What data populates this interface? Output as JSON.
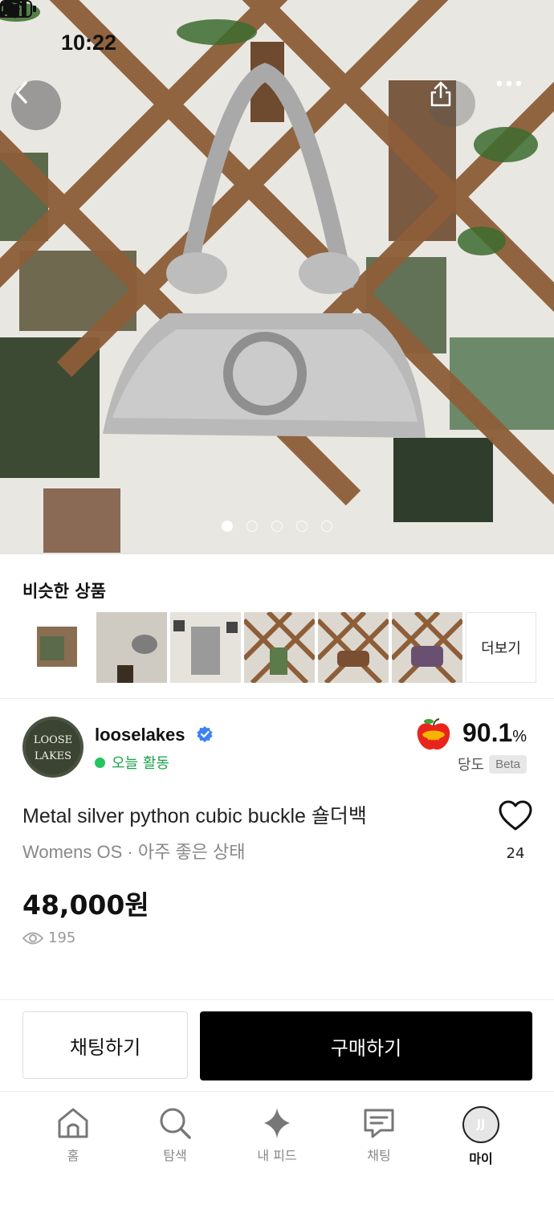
{
  "status_bar": {
    "time": "10:22"
  },
  "hero": {
    "image_count": 5,
    "active_index": 0
  },
  "similar": {
    "title": "비슷한 상품",
    "more_label": "더보기"
  },
  "seller": {
    "name": "looselakes",
    "activity": "오늘 활동",
    "score_value": "90.1",
    "score_unit": "%",
    "score_label": "당도",
    "score_badge": "Beta",
    "avatar_text": [
      "LOOSE",
      "LAKES"
    ]
  },
  "product": {
    "title": "Metal silver python cubic buckle 숄더백",
    "meta": "Womens OS · 아주 좋은 상태",
    "likes": "24",
    "price": "48,000원",
    "views": "195"
  },
  "actions": {
    "chat_label": "채팅하기",
    "buy_label": "구매하기"
  },
  "tabs": [
    {
      "label": "홈",
      "icon": "home-icon"
    },
    {
      "label": "탐색",
      "icon": "search-icon"
    },
    {
      "label": "내 피드",
      "icon": "sparkle-icon"
    },
    {
      "label": "채팅",
      "icon": "chat-icon"
    },
    {
      "label": "마이",
      "icon": "avatar",
      "avatar_text": "JJ"
    }
  ],
  "colors": {
    "accent_green": "#22c55e",
    "verified_blue": "#3b82f6",
    "buy_button": "#000000"
  }
}
